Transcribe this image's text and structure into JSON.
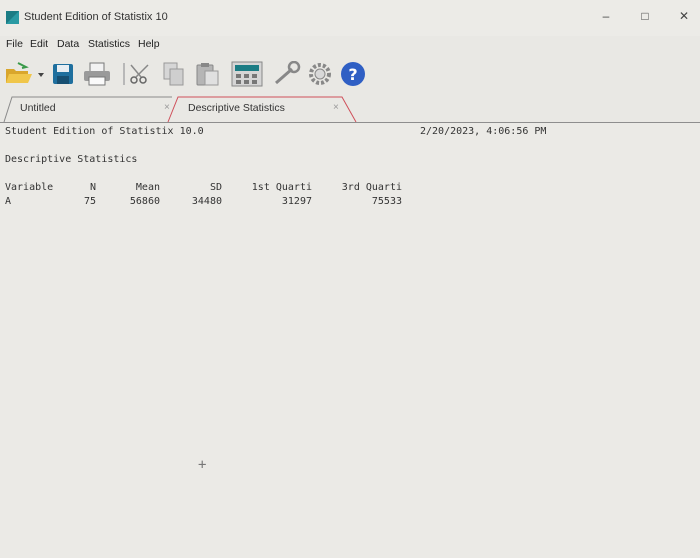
{
  "window": {
    "title": "Student Edition of Statistix 10",
    "controls": {
      "minimize": "–",
      "maximize": "□",
      "close": "✕"
    }
  },
  "menu": [
    "File",
    "Edit",
    "Data",
    "Statistics",
    "Help"
  ],
  "toolbar": {
    "icons": [
      "open-folder-icon",
      "dropdown-arrow-icon",
      "save-icon",
      "print-icon",
      "cut-icon",
      "copy-icon",
      "paste-icon",
      "calculator-icon",
      "wrench-icon",
      "settings-gear-icon",
      "help-icon"
    ],
    "help_glyph": "?"
  },
  "tabs": [
    {
      "label": "Untitled",
      "close": "×"
    },
    {
      "label": "Descriptive Statistics",
      "close": "×"
    }
  ],
  "report": {
    "header_left": "Student Edition of Statistix 10.0",
    "header_right": "2/20/2023, 4:06:56 PM",
    "section_title": "Descriptive Statistics",
    "columns": [
      "Variable",
      "N",
      "Mean",
      "SD",
      "1st Quarti",
      "3rd Quarti"
    ],
    "rows": [
      {
        "variable": "A",
        "n": "75",
        "mean": "56860",
        "sd": "34480",
        "q1": "31297",
        "q3": "75533"
      }
    ]
  },
  "cursor_glyph": "+",
  "colors": {
    "accent": "#cf4f5a",
    "icon_teal": "#1b7c84",
    "help_blue": "#2f5fc4"
  }
}
